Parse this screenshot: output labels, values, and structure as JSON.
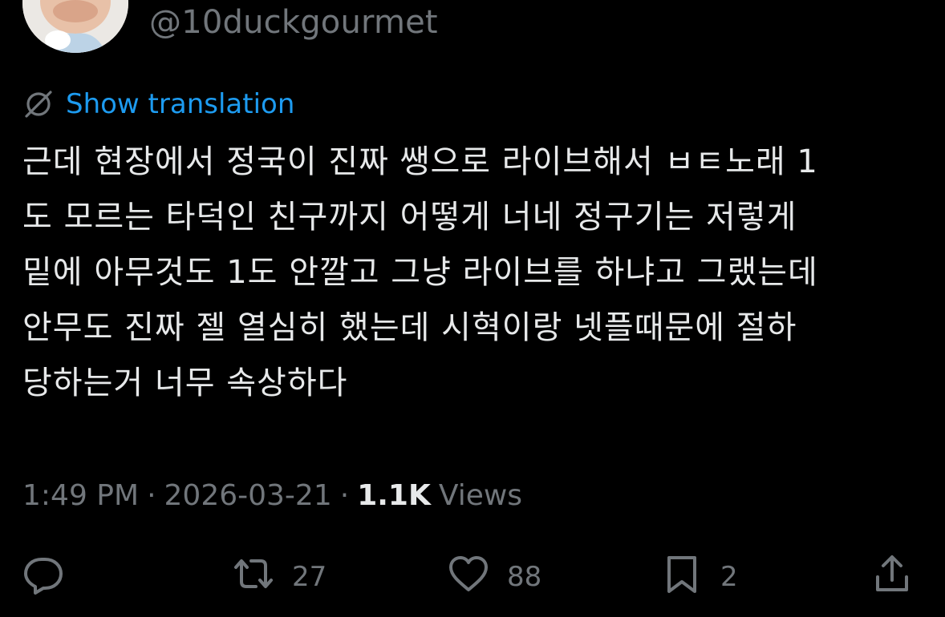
{
  "author": {
    "handle": "@10duckgourmet"
  },
  "translation": {
    "label": "Show translation",
    "icon": "globe-slash-icon"
  },
  "tweet": {
    "text": "근데 현장에서 정국이 진짜 쌩으로 라이브해서 ㅂㅌ노래 1\n도 모르는 타덕인 친구까지 어떻게 너네 정구기는 저렇게\n밑에 아무것도 1도 안깔고 그냥 라이브를 하냐고 그랬는데\n안무도 진짜 젤 열심히 했는데 시혁이랑 넷플때문에 절하\n당하는거 너무 속상하다"
  },
  "meta": {
    "time": "1:49 PM",
    "separator": "·",
    "date": "2026-03-21",
    "views_count": "1.1K",
    "views_label": "Views"
  },
  "actions": {
    "reply": {
      "icon": "reply-icon"
    },
    "retweet": {
      "icon": "retweet-icon",
      "count": "27"
    },
    "like": {
      "icon": "heart-icon",
      "count": "88"
    },
    "bookmark": {
      "icon": "bookmark-icon",
      "count": "2"
    },
    "share": {
      "icon": "share-icon"
    }
  },
  "colors": {
    "background": "#000000",
    "text": "#e7e9ea",
    "secondary": "#71767b",
    "link": "#1d9bf0"
  }
}
